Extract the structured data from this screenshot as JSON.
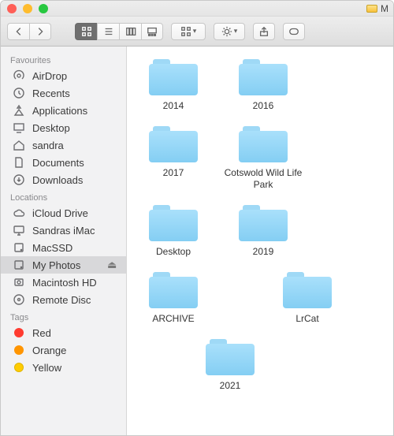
{
  "title_suffix": "M",
  "sidebar": {
    "sections": [
      {
        "heading": "Favourites",
        "items": [
          {
            "icon": "airdrop",
            "label": "AirDrop"
          },
          {
            "icon": "recents",
            "label": "Recents"
          },
          {
            "icon": "apps",
            "label": "Applications"
          },
          {
            "icon": "desktop",
            "label": "Desktop"
          },
          {
            "icon": "home",
            "label": "sandra"
          },
          {
            "icon": "documents",
            "label": "Documents"
          },
          {
            "icon": "downloads",
            "label": "Downloads"
          }
        ]
      },
      {
        "heading": "Locations",
        "items": [
          {
            "icon": "cloud",
            "label": "iCloud Drive"
          },
          {
            "icon": "imac",
            "label": "Sandras iMac"
          },
          {
            "icon": "disk",
            "label": "MacSSD"
          },
          {
            "icon": "disk",
            "label": "My Photos",
            "selected": true,
            "eject": true
          },
          {
            "icon": "hdd",
            "label": "Macintosh HD"
          },
          {
            "icon": "disc",
            "label": "Remote Disc"
          }
        ]
      },
      {
        "heading": "Tags",
        "items": [
          {
            "icon": "tag",
            "color": "red",
            "label": "Red"
          },
          {
            "icon": "tag",
            "color": "orange",
            "label": "Orange"
          },
          {
            "icon": "tag",
            "color": "yellow",
            "label": "Yellow"
          }
        ]
      }
    ]
  },
  "folders": [
    {
      "name": "2014"
    },
    {
      "name": "2016"
    },
    {
      "name": "2017"
    },
    {
      "name": "Cotswold  Wild Life Park"
    },
    {
      "name": "Desktop"
    },
    {
      "name": "2019"
    },
    {
      "name": "ARCHIVE"
    },
    {
      "name": "LrCat",
      "offset": true
    },
    {
      "name": "2021",
      "center": true
    }
  ]
}
